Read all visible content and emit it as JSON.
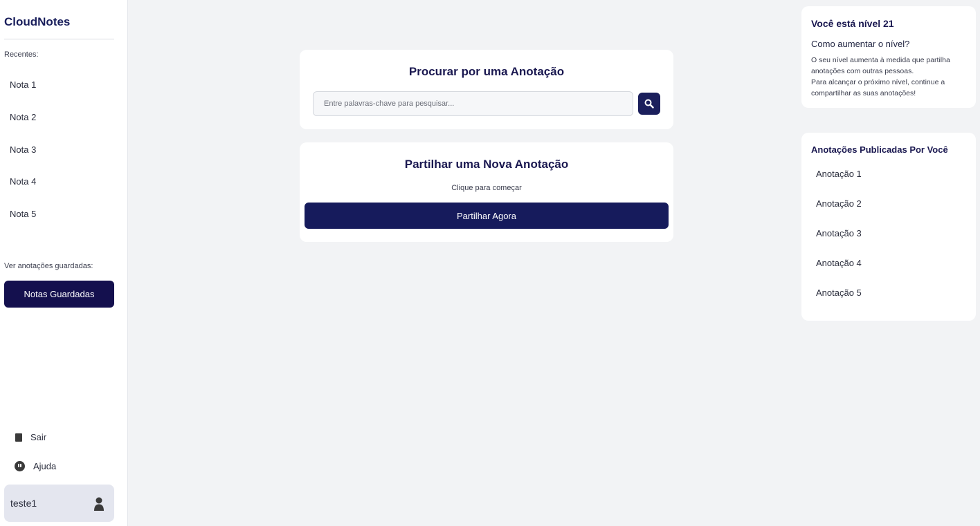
{
  "sidebar": {
    "brand": "CloudNotes",
    "recent_label": "Recentes:",
    "recent_items": [
      "Nota 1",
      "Nota 2",
      "Nota 3",
      "Nota 4",
      "Nota 5"
    ],
    "saved_label": "Ver anotações guardadas:",
    "saved_button": "Notas Guardadas",
    "logout_label": "Sair",
    "help_label": "Ajuda",
    "user_name": "teste1"
  },
  "search": {
    "title": "Procurar por uma Anotação",
    "placeholder": "Entre palavras-chave para pesquisar...",
    "value": ""
  },
  "share": {
    "title": "Partilhar uma Nova Anotação",
    "subtitle": "Clique para começar",
    "button": "Partilhar Agora"
  },
  "level": {
    "title": "Você está nível 21",
    "subtitle": "Como aumentar o nível?",
    "description_1": "O seu nível aumenta à medida que partilha anotações com outras pessoas.",
    "description_2": "Para alcançar o próximo nível, continue a compartilhar as suas anotações!"
  },
  "published": {
    "title": "Anotações Publicadas Por Você",
    "items": [
      "Anotação 1",
      "Anotação 2",
      "Anotação 3",
      "Anotação 4",
      "Anotação 5"
    ]
  },
  "colors": {
    "primary": "#161b5c",
    "dark_button": "#14104e",
    "background": "#f2f3f5"
  }
}
